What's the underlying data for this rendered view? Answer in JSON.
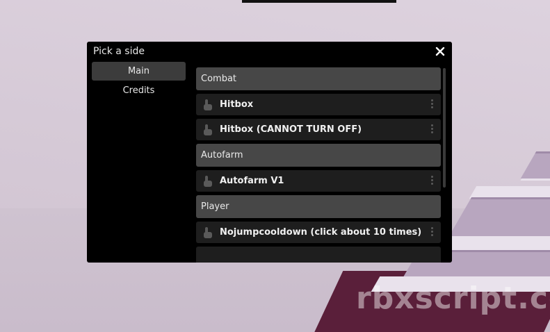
{
  "window": {
    "title": "Pick a side",
    "close_glyph": "✕"
  },
  "sidebar": {
    "tabs": [
      {
        "label": "Main",
        "active": true
      },
      {
        "label": "Credits",
        "active": false
      }
    ]
  },
  "main": {
    "sections": [
      {
        "title": "Combat",
        "items": [
          "Hitbox",
          "Hitbox (CANNOT TURN OFF)"
        ]
      },
      {
        "title": "Autofarm",
        "items": [
          "Autofarm V1"
        ]
      },
      {
        "title": "Player",
        "items": [
          "Nojumpcooldown (click about 10 times)"
        ]
      }
    ]
  },
  "background": {
    "watermark": "rbxscript.co"
  },
  "icons": {
    "item_icon": "hand-pointer-icon",
    "menu_icon": "vertical-dots-icon",
    "close_icon": "close-icon"
  }
}
